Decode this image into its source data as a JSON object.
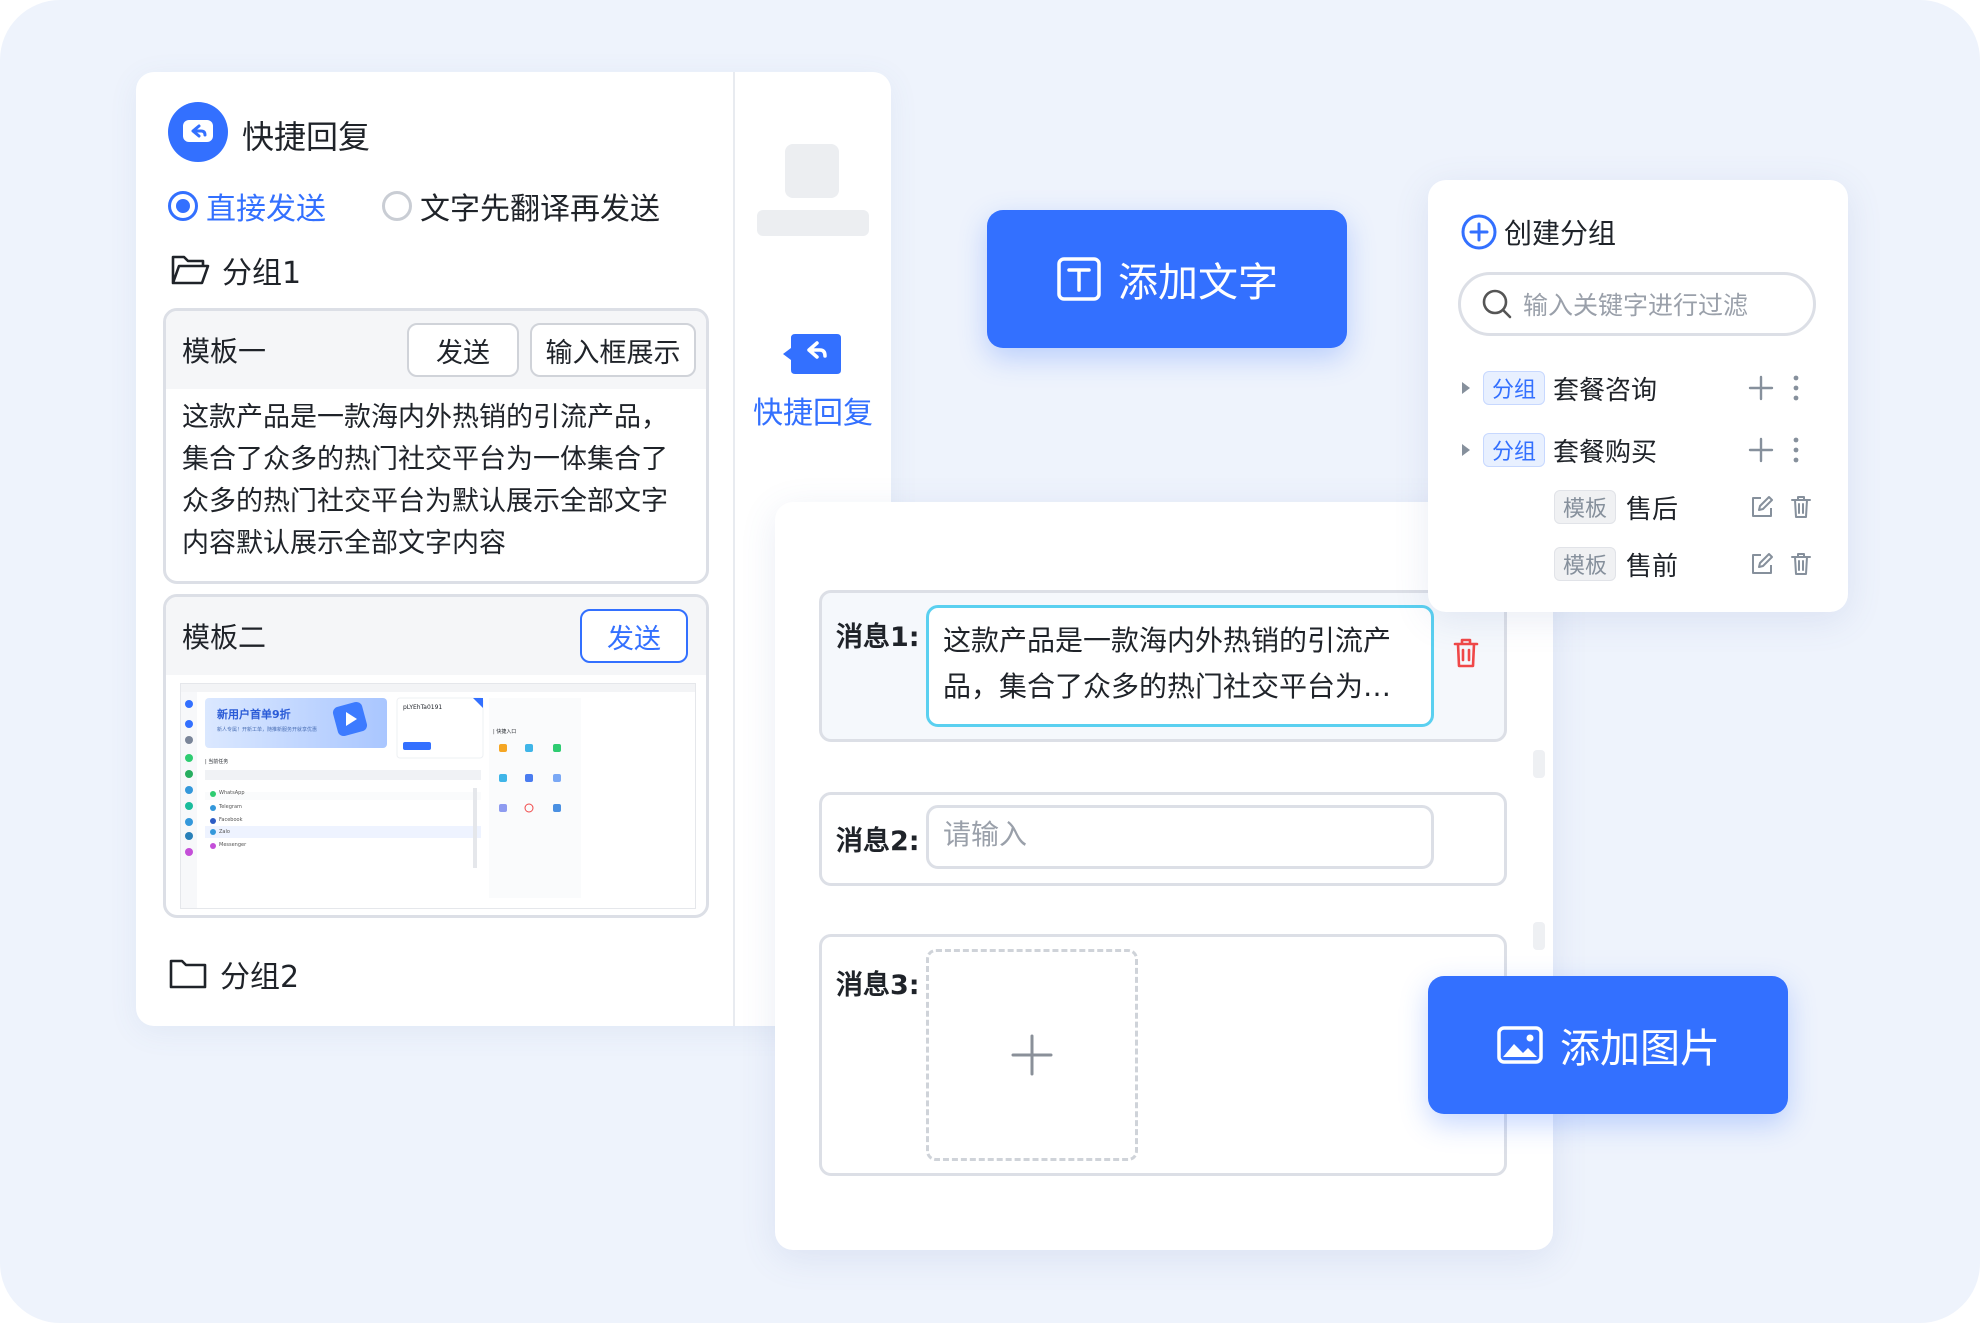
{
  "quick_reply": {
    "title": "快捷回复",
    "radio_direct": "直接发送",
    "radio_translate": "文字先翻译再发送",
    "group1": "分组1",
    "group2": "分组2",
    "template1": {
      "name": "模板一",
      "send_label": "发送",
      "show_in_input_label": "输入框展示",
      "text": "这款产品是一款海内外热销的引流产品，集合了众多的热门社交平台为一体集合了众多的热门社交平台为默认展示全部文字内容默认展示全部文字内容"
    },
    "template2": {
      "name": "模板二",
      "send_label": "发送",
      "screenshot": {
        "banner_text": "新用户首单9折",
        "banner_sub": "新人专属！开新工单，随推新服务开就享优惠",
        "profile_name": "pLYEhTa0191",
        "section_title": "| 当前任务",
        "quick_title": "| 快捷入口",
        "rows": [
          "WhatsApp",
          "Telegram",
          "Facebook",
          "Zalo",
          "Messenger"
        ]
      }
    },
    "side_label": "快捷回复"
  },
  "add_text_button": "添加文字",
  "add_image_button": "添加图片",
  "messages": {
    "msg1_label": "消息1:",
    "msg1_text": "这款产品是一款海内外热销的引流产品，集合了众多的热门社交平台为…",
    "msg2_label": "消息2:",
    "msg2_placeholder": "请输入",
    "msg3_label": "消息3:"
  },
  "groups_panel": {
    "create_label": "创建分组",
    "search_placeholder": "输入关键字进行过滤",
    "group_tag": "分组",
    "template_tag": "模板",
    "items": [
      {
        "type": "group",
        "name": "套餐咨询"
      },
      {
        "type": "group",
        "name": "套餐购买"
      },
      {
        "type": "template",
        "name": "售后"
      },
      {
        "type": "template",
        "name": "售前"
      }
    ]
  },
  "colors": {
    "accent": "#3370ff",
    "danger": "#f04848",
    "focus": "#5ad0f0"
  }
}
